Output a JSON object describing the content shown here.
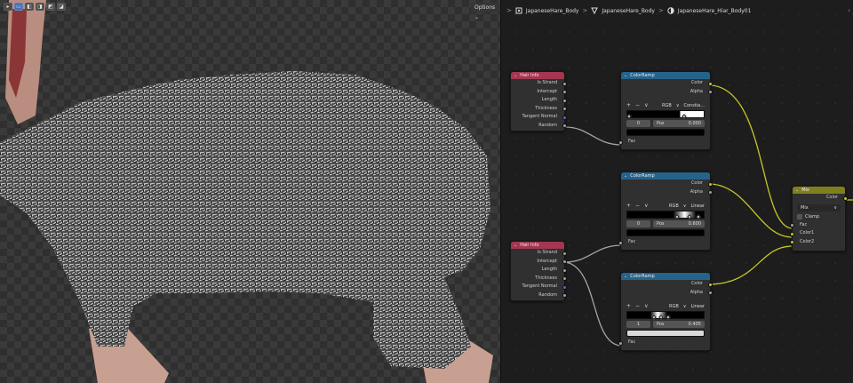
{
  "viewport": {
    "options_label": "Options",
    "options_chevron": "⌄",
    "toolbar_icons": [
      "cursor-icon",
      "select-box-icon",
      "select-extend-icon",
      "select-subtract-icon",
      "select-invert-icon",
      "select-intersect-icon"
    ]
  },
  "breadcrumb": {
    "items": [
      "JapaneseHare_Body",
      "JapaneseHare_Body",
      "JapaneseHare_Hiar_Body01"
    ],
    "separator": ">"
  },
  "nodes": {
    "hair_info_1": {
      "title": "Hair Info",
      "outputs": [
        "Is Strand",
        "Intercept",
        "Length",
        "Thickness",
        "Tangent Normal",
        "Random"
      ]
    },
    "hair_info_2": {
      "title": "Hair Info",
      "outputs": [
        "Is Strand",
        "Intercept",
        "Length",
        "Thickness",
        "Tangent Normal",
        "Random"
      ]
    },
    "colorramp_1": {
      "title": "ColorRamp",
      "outputs": [
        "Color",
        "Alpha"
      ],
      "color_mode": "RGB",
      "interpolation": "Constia...",
      "stop_index": "0",
      "pos_label": "Pos",
      "pos_value": "0.000",
      "input": "Fac"
    },
    "colorramp_2": {
      "title": "ColorRamp",
      "outputs": [
        "Color",
        "Alpha"
      ],
      "color_mode": "RGB",
      "interpolation": "Linear",
      "stop_index": "0",
      "pos_label": "Pos",
      "pos_value": "0.600",
      "input": "Fac"
    },
    "colorramp_3": {
      "title": "ColorRamp",
      "outputs": [
        "Color",
        "Alpha"
      ],
      "color_mode": "RGB",
      "interpolation": "Linear",
      "stop_index": "1",
      "pos_label": "Pos",
      "pos_value": "0.405",
      "input": "Fac"
    },
    "mix": {
      "title": "Mix",
      "output": "Color",
      "blend_type": "Mix",
      "clamp_label": "Clamp",
      "inputs": [
        "Fac",
        "Color1",
        "Color2"
      ]
    }
  },
  "glyphs": {
    "chevron": "⌄",
    "plus": "+",
    "minus": "−",
    "caret": "∨"
  },
  "colors": {
    "hair_info_header": "#a33650",
    "colorramp_header": "#26638b",
    "mix_header": "#7f7f1e",
    "wire_gray": "#a5a5a5",
    "wire_yellow": "#c7c729"
  }
}
